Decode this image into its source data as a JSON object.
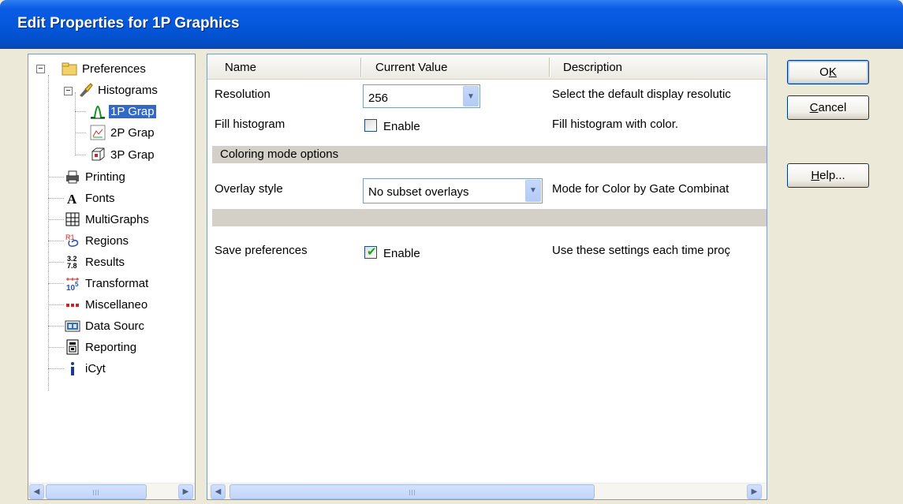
{
  "window": {
    "title": "Edit Properties for 1P Graphics"
  },
  "tree": {
    "items": [
      {
        "label": "Preferences",
        "icon": "folder-icon"
      },
      {
        "label": "Histograms",
        "icon": "histograms-brush-icon"
      },
      {
        "label": "1P Grap",
        "icon": "1p-graph-icon",
        "selected": true
      },
      {
        "label": "2P Grap",
        "icon": "2p-graph-icon"
      },
      {
        "label": "3P Grap",
        "icon": "3p-graph-icon"
      },
      {
        "label": "Printing",
        "icon": "printer-icon"
      },
      {
        "label": "Fonts",
        "icon": "font-icon"
      },
      {
        "label": "MultiGraphs",
        "icon": "multigraph-icon"
      },
      {
        "label": "Regions",
        "icon": "regions-icon"
      },
      {
        "label": "Results",
        "icon": "results-icon"
      },
      {
        "label": "Transformat",
        "icon": "transformation-icon"
      },
      {
        "label": "Miscellaneo",
        "icon": "miscellaneous-icon"
      },
      {
        "label": "Data Sourc",
        "icon": "data-source-icon"
      },
      {
        "label": "Reporting",
        "icon": "reporting-icon"
      },
      {
        "label": "iCyt",
        "icon": "info-icon"
      }
    ],
    "expander_minus": "−"
  },
  "grid": {
    "columns": [
      "Name",
      "Current Value",
      "Description"
    ],
    "rows": {
      "resolution": {
        "name": "Resolution",
        "value": "256",
        "description": "Select the default display resolutic"
      },
      "fill_histogram": {
        "name": "Fill histogram",
        "checkbox_label": "Enable",
        "checked": false,
        "description": "Fill histogram with color."
      },
      "section_coloring": {
        "label": "Coloring mode options"
      },
      "overlay_style": {
        "name": "Overlay style",
        "value": "No subset overlays",
        "description": "Mode for Color by Gate Combinat"
      },
      "save_preferences": {
        "name": "Save preferences",
        "checkbox_label": "Enable",
        "checked": true,
        "description": "Use these settings each time proç"
      }
    }
  },
  "buttons": {
    "ok": {
      "pre": "O",
      "underline": "K",
      "post": ""
    },
    "cancel": {
      "pre": "",
      "underline": "C",
      "post": "ancel"
    },
    "help": {
      "pre": "",
      "underline": "H",
      "post": "elp..."
    }
  },
  "glyphs": {
    "dropdown_arrow": "▼",
    "scroll_left": "◀",
    "scroll_right": "▶",
    "check": "✔"
  },
  "colors": {
    "title_bar": "#0355d8",
    "selection": "#316ac5",
    "window_bg": "#ece9d8",
    "section_row": "#d4d0c8"
  }
}
